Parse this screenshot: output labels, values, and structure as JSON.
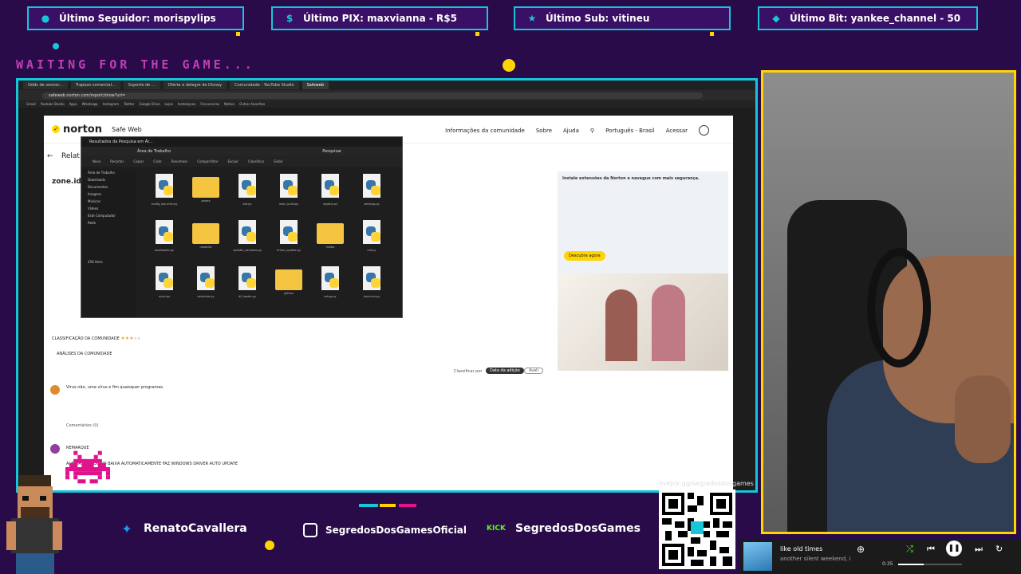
{
  "alerts": [
    {
      "label": "Último Seguidor: morispylips",
      "icon": "person-icon"
    },
    {
      "label": "Último PIX: maxvianna - R$5",
      "icon": "dollar-icon"
    },
    {
      "label": "Último Sub: vitineu",
      "icon": "star-icon"
    },
    {
      "label": "Último Bit: yankee_channel - 50",
      "icon": "diamond-icon"
    }
  ],
  "waiting_text": "WAITING FOR THE GAME...",
  "browser": {
    "tabs": [
      "Odds de vencer...",
      "Trapezo comercial...",
      "Suporte de ...",
      "Oferta a delegre de Disney",
      "Comunidade - YouTube Studio",
      "Safeweb"
    ],
    "url": "safeweb.norton.com/report/show?url=",
    "bookmarks": [
      "Gmail",
      "Youtube Studio",
      "Apps",
      "Whatsapp",
      "Instagram",
      "Twitter",
      "Google Drive",
      "Lojas",
      "Instalaçoes",
      "Frecuencias",
      "Notion",
      "Outros favoritos"
    ]
  },
  "norton": {
    "brand": "norton",
    "product": "Safe Web",
    "nav": [
      "Informações da comunidade",
      "Sobre",
      "Ajuda",
      "Português - Brasil",
      "Acessar"
    ],
    "section_title": "Relat",
    "domain": "zone.id",
    "community_rating_label": "CLASSIFICAÇÃO DA COMUNIDADE",
    "community_reviews_label": "ANÁLISES DA COMUNIDADE",
    "sort_label": "Classificar por",
    "sort_active": "Data da adição",
    "sort_other": "Avali",
    "review1_title": "Vírus não, uma vírus e fim quaisquer programas.",
    "review2_user": "REMARQUE",
    "review2_text": "ALERTA: O ARQUIVO BAIXA AUTOMATICAMENTE FAZ WINDOWS DRIVER AUTO UPDATE",
    "comments_label": "Comentários (0)",
    "promo_title": "Instale extensões da Norton e navegue com mais segurança.",
    "promo_button": "Descubra agora"
  },
  "explorer": {
    "window_title": "Resultados da Pesquisa em Ár...",
    "path": "Área de Trabalho",
    "search_placeholder": "Pesquisar",
    "tools": [
      "Novo",
      "Recortar",
      "Copiar",
      "Colar",
      "Renomear",
      "Compartilhar",
      "Excluir",
      "Classificar",
      "Exibir"
    ],
    "sidebar": [
      "Área de Trabalho",
      "Downloads",
      "Documentos",
      "Imagens",
      "Músicas",
      "Vídeos",
      "Este Computador",
      "Rede"
    ],
    "items": [
      {
        "type": "py",
        "label": "config_launcher.py"
      },
      {
        "type": "folder",
        "label": "assets"
      },
      {
        "type": "py",
        "label": "bot.py"
      },
      {
        "type": "py",
        "label": "main_build.py"
      },
      {
        "type": "py",
        "label": "registry.py"
      },
      {
        "type": "py",
        "label": "settings.py"
      },
      {
        "type": "py",
        "label": "bootloader.py"
      },
      {
        "type": "folder",
        "label": "modules"
      },
      {
        "type": "py",
        "label": "updater_windows.py"
      },
      {
        "type": "py",
        "label": "driver_update.py"
      },
      {
        "type": "folder",
        "label": "media"
      },
      {
        "type": "py",
        "label": "init.py"
      },
      {
        "type": "py",
        "label": "main.py"
      },
      {
        "type": "py",
        "label": "extractor.py"
      },
      {
        "type": "py",
        "label": "dll_loader.py"
      },
      {
        "type": "folder",
        "label": "python"
      },
      {
        "type": "py",
        "label": "setup.py"
      },
      {
        "type": "py",
        "label": "launcher.py"
      }
    ],
    "status": "258 itens"
  },
  "socials": [
    {
      "handle": "RenatoCavallera",
      "icon": "twitter-icon",
      "color": "#1d9bf0"
    },
    {
      "handle": "SegredosDosGamesOficial",
      "icon": "instagram-icon",
      "color": "#c13584"
    },
    {
      "handle": "SegredosDosGames",
      "icon": "kick-icon",
      "color": "#53fc18"
    }
  ],
  "social_kick_badge": "KICK",
  "qr_label": "livepix.gg/segredosdosgames",
  "player": {
    "title": "like old times",
    "subtitle": "another silent weekend, i",
    "time": "0:35",
    "progress": 0.4
  },
  "colors": {
    "accent": "#15c7d8",
    "yellow": "#ffd400",
    "bg": "#2a0b4a"
  }
}
